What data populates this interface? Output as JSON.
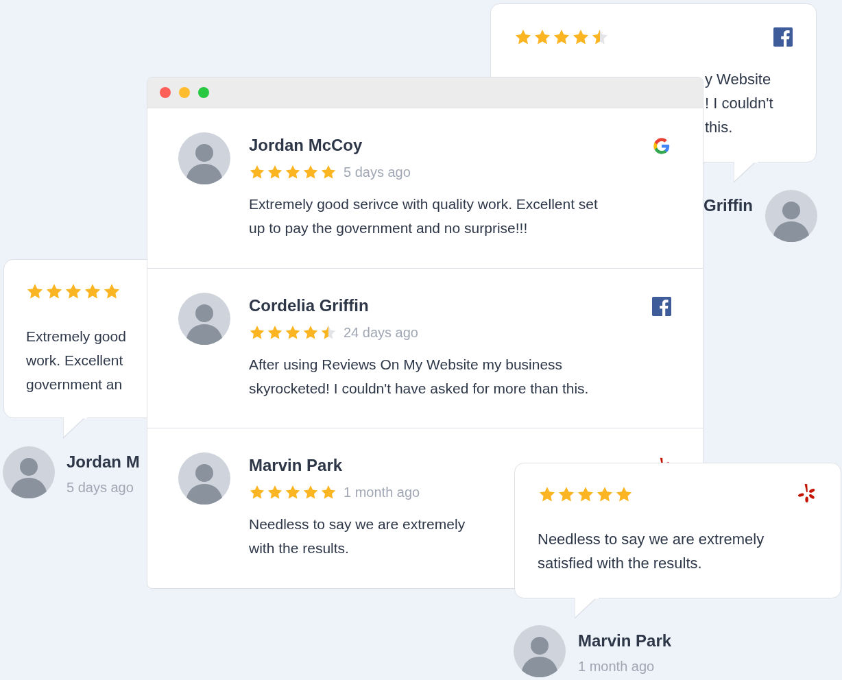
{
  "background_cards": [
    {
      "stars": 4.5,
      "kind": "facebook",
      "text_lines": [
        "y Website",
        "! I couldn't",
        "this."
      ],
      "name": "Griffin"
    },
    {
      "stars": 5,
      "text_lines": [
        "Extremely good",
        "work. Excellent",
        "government an"
      ],
      "name": "Jordan M",
      "time": "5 days ago"
    }
  ],
  "reviews": [
    {
      "name": "Jordan McCoy",
      "stars": 5,
      "time": "5 days ago",
      "kind": "google",
      "text_lines": [
        "Extremely good serivce with quality work. Excellent set",
        "up to pay the government and no surprise!!!"
      ]
    },
    {
      "name": "Cordelia Griffin",
      "stars": 4.5,
      "time": "24 days ago",
      "kind": "facebook",
      "text_lines": [
        "After using Reviews On My Website my business",
        "skyrocketed! I couldn't have asked for more than this."
      ]
    },
    {
      "name": "Marvin Park",
      "stars": 5,
      "time": "1 month ago",
      "kind": "yelp",
      "text_lines": [
        "Needless to say we are extremely",
        "with the results."
      ]
    }
  ],
  "popup_card": {
    "stars": 5,
    "kind": "yelp",
    "text_lines": [
      "Needless to say we are extremely",
      "satisfied with the results."
    ],
    "name": "Marvin Park",
    "time": "1 month ago"
  }
}
